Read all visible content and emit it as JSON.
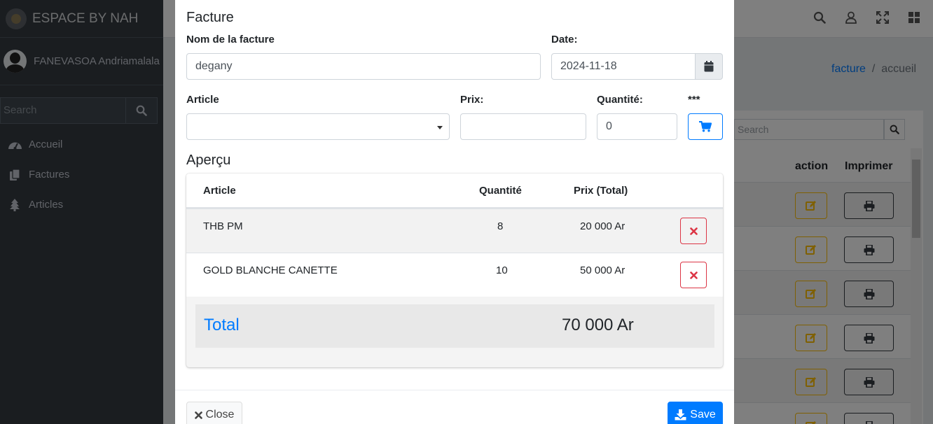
{
  "app": {
    "brand": "ESPACE BY NAH"
  },
  "sidebar": {
    "user_name": "FANEVASOA Andriamalala",
    "search_placeholder": "Search",
    "items": [
      {
        "label": "Accueil",
        "icon": "dashboard-icon"
      },
      {
        "label": "Factures",
        "icon": "copy-icon"
      },
      {
        "label": "Articles",
        "icon": "tree-icon"
      }
    ]
  },
  "breadcrumb": {
    "link": "facture",
    "separator": "/",
    "current": "accueil"
  },
  "background_table": {
    "search_placeholder": "Search",
    "headers": [
      "action",
      "Imprimer"
    ]
  },
  "modal": {
    "title": "Facture",
    "name_label": "Nom de la facture",
    "name_value": "degany",
    "date_label": "Date:",
    "date_value": "2024-11-18",
    "article_label": "Article",
    "article_value": "",
    "prix_label": "Prix:",
    "prix_value": "",
    "quantite_label": "Quantité:",
    "quantite_value": "0",
    "stars_label": "***",
    "preview_title": "Aperçu",
    "table": {
      "headers": [
        "Article",
        "Quantité",
        "Prix (Total)"
      ],
      "rows": [
        {
          "article": "THB PM",
          "quantite": "8",
          "prix": "20 000 Ar"
        },
        {
          "article": "GOLD BLANCHE CANETTE",
          "quantite": "10",
          "prix": "50 000 Ar"
        }
      ]
    },
    "total_label": "Total",
    "total_value": "70 000 Ar",
    "close_label": "Close",
    "save_label": "Save"
  },
  "colors": {
    "primary": "#007bff",
    "danger": "#dc3545",
    "warning": "#ffc107",
    "sidebar": "#343a40"
  }
}
